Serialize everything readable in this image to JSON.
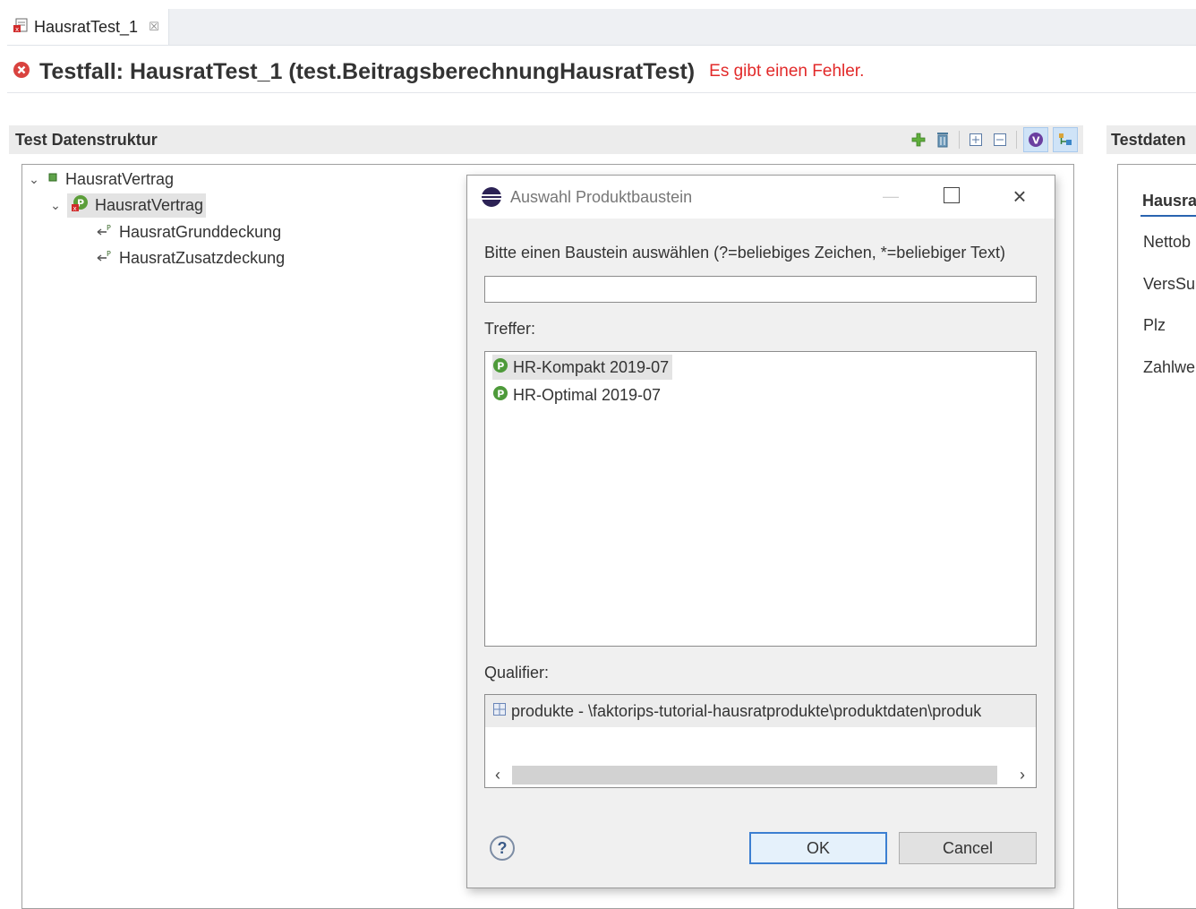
{
  "editor_tab": {
    "label": "HausratTest_1",
    "close_glyph": "☒"
  },
  "header": {
    "title": "Testfall: HausratTest_1 (test.BeitragsberechnungHausratTest)",
    "error_message": "Es gibt einen Fehler."
  },
  "left_section": {
    "title": "Test Datenstruktur",
    "toolbar": [
      "add-icon",
      "delete-icon",
      "expand-all-icon",
      "collapse-all-icon",
      "validate-icon",
      "link-icon"
    ],
    "tree": [
      {
        "label": "HausratVertrag",
        "level": 0,
        "expanded": true,
        "icon": "policy-type-icon"
      },
      {
        "label": "HausratVertrag",
        "level": 1,
        "expanded": true,
        "icon": "policy-instance-error-icon",
        "selected": true
      },
      {
        "label": "HausratGrunddeckung",
        "level": 2,
        "icon": "coverage-link-icon"
      },
      {
        "label": "HausratZusatzdeckung",
        "level": 2,
        "icon": "coverage-link-icon"
      }
    ]
  },
  "right_section": {
    "title": "Testdaten",
    "group_title": "Hausra",
    "fields": [
      "Nettob",
      "VersSu",
      "Plz",
      "Zahlwe"
    ]
  },
  "dialog": {
    "title": "Auswahl Produktbaustein",
    "prompt": "Bitte einen Baustein auswählen (?=beliebiges Zeichen, *=beliebiger Text)",
    "search_value": "",
    "results_label": "Treffer:",
    "results": [
      "HR-Kompakt 2019-07",
      "HR-Optimal 2019-07"
    ],
    "qualifier_label": "Qualifier:",
    "qualifier_value": "produkte - \\faktorips-tutorial-hausratprodukte\\produktdaten\\produk",
    "ok_label": "OK",
    "cancel_label": "Cancel",
    "help_glyph": "?"
  },
  "colors": {
    "error": "#e22a2a",
    "accent": "#3c7fd1",
    "selection": "#e4e4e4"
  }
}
